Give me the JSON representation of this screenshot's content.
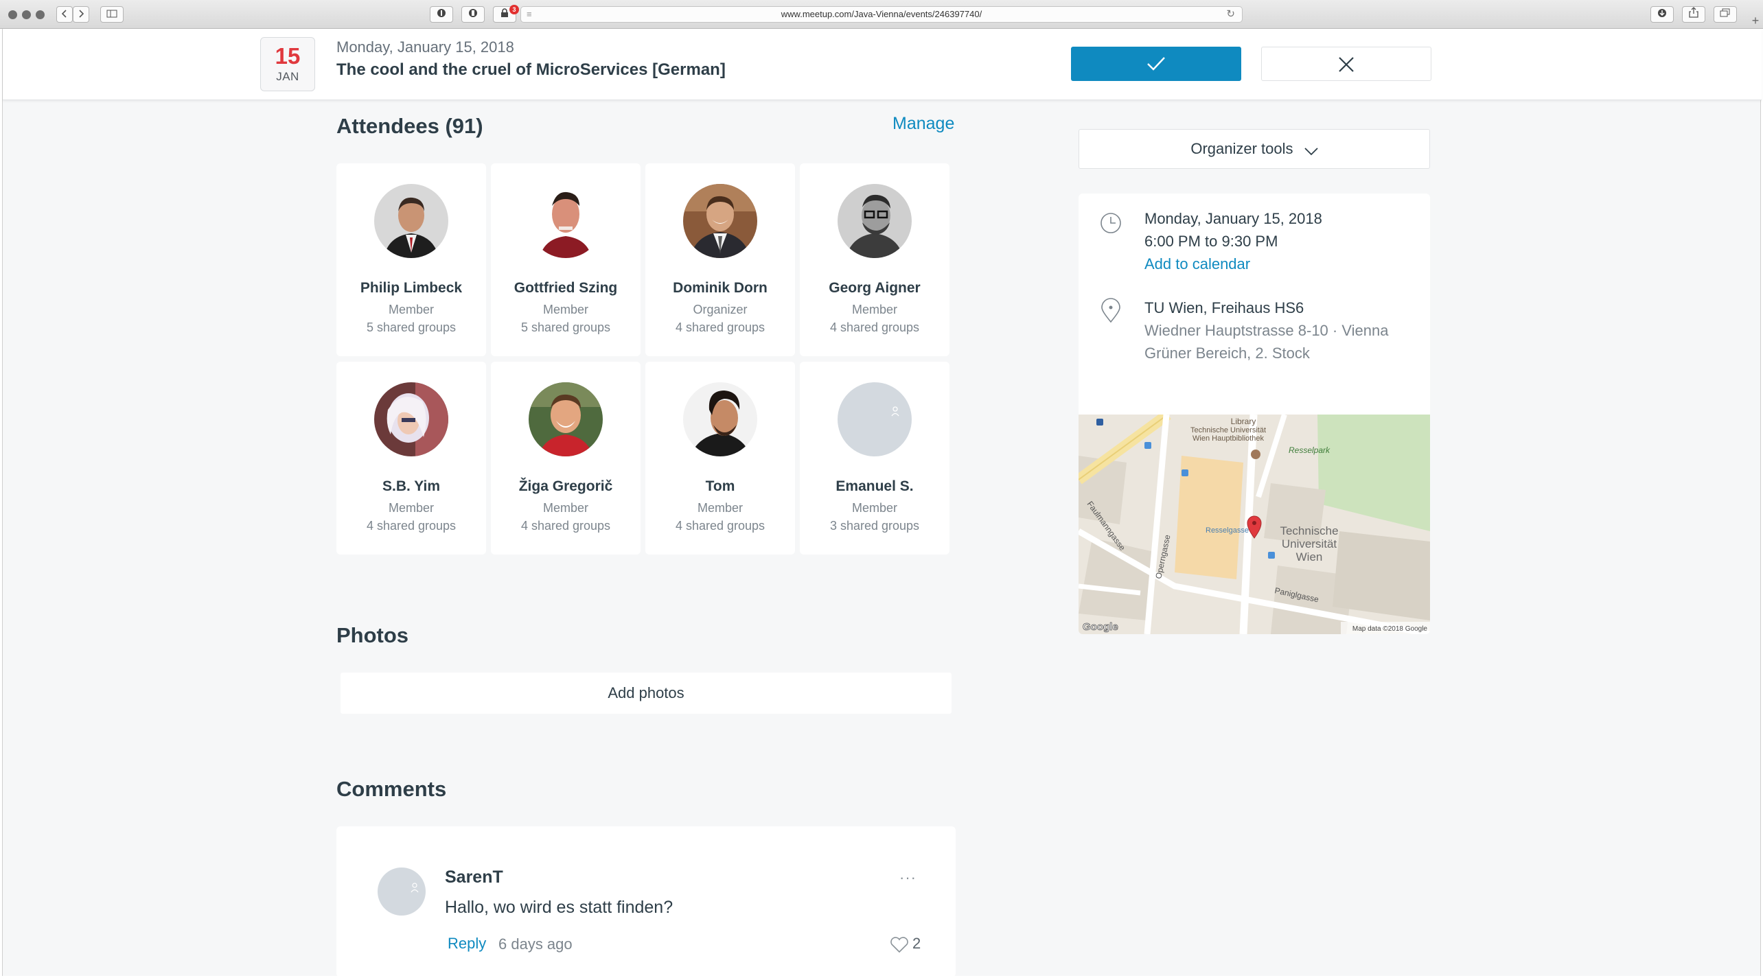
{
  "browser": {
    "url": "www.meetup.com/Java-Vienna/events/246397740/",
    "notification_count": "3"
  },
  "event": {
    "day": "15",
    "month": "JAN",
    "date_text": "Monday, January 15, 2018",
    "title": "The cool and the cruel of MicroServices [German]"
  },
  "attendees": {
    "title": "Attendees (91)",
    "manage_label": "Manage",
    "items": [
      {
        "name": "Philip Limbeck",
        "role": "Member",
        "groups": "5 shared groups"
      },
      {
        "name": "Gottfried Szing",
        "role": "Member",
        "groups": "5 shared groups"
      },
      {
        "name": "Dominik Dorn",
        "role": "Organizer",
        "groups": "4 shared groups"
      },
      {
        "name": "Georg Aigner",
        "role": "Member",
        "groups": "4 shared groups"
      },
      {
        "name": "S.B. Yim",
        "role": "Member",
        "groups": "4 shared groups"
      },
      {
        "name": "Žiga Gregorič",
        "role": "Member",
        "groups": "4 shared groups"
      },
      {
        "name": "Tom",
        "role": "Member",
        "groups": "4 shared groups"
      },
      {
        "name": "Emanuel S.",
        "role": "Member",
        "groups": "3 shared groups"
      }
    ]
  },
  "photos": {
    "title": "Photos",
    "add_label": "Add photos"
  },
  "comments": {
    "title": "Comments",
    "items": [
      {
        "author": "SarenT",
        "text": "Hallo, wo wird es statt finden?",
        "reply_label": "Reply",
        "time": "6 days ago",
        "likes": "2",
        "more": "···"
      }
    ]
  },
  "sidebar": {
    "organizer_tools_label": "Organizer tools",
    "date_line": "Monday, January 15, 2018",
    "time_line": "6:00 PM to 9:30 PM",
    "add_calendar_label": "Add to calendar",
    "venue_name": "TU Wien, Freihaus HS6",
    "venue_address": "Wiedner Hauptstrasse 8-10 · Vienna",
    "venue_detail": "Grüner Bereich, 2. Stock"
  },
  "map": {
    "labels": {
      "library": "Library",
      "library_full_1": "Technische Universität",
      "library_full_2": "Wien Hauptbibliothek",
      "resselpark": "Resselpark",
      "resselgasse": "Resselgasse",
      "tu_1": "Technische",
      "tu_2": "Universität",
      "tu_3": "Wien",
      "faulmanngasse": "Faulmanngasse",
      "operngasse": "Operngasse",
      "paniglgasse": "Paniglgasse",
      "google": "Google",
      "attribution": "Map data ©2018 Google"
    }
  },
  "colors": {
    "accent": "#0f8ac0",
    "date_red": "#e0393e",
    "page_bg": "#f6f7f8",
    "text_dark": "#2e3e48"
  }
}
